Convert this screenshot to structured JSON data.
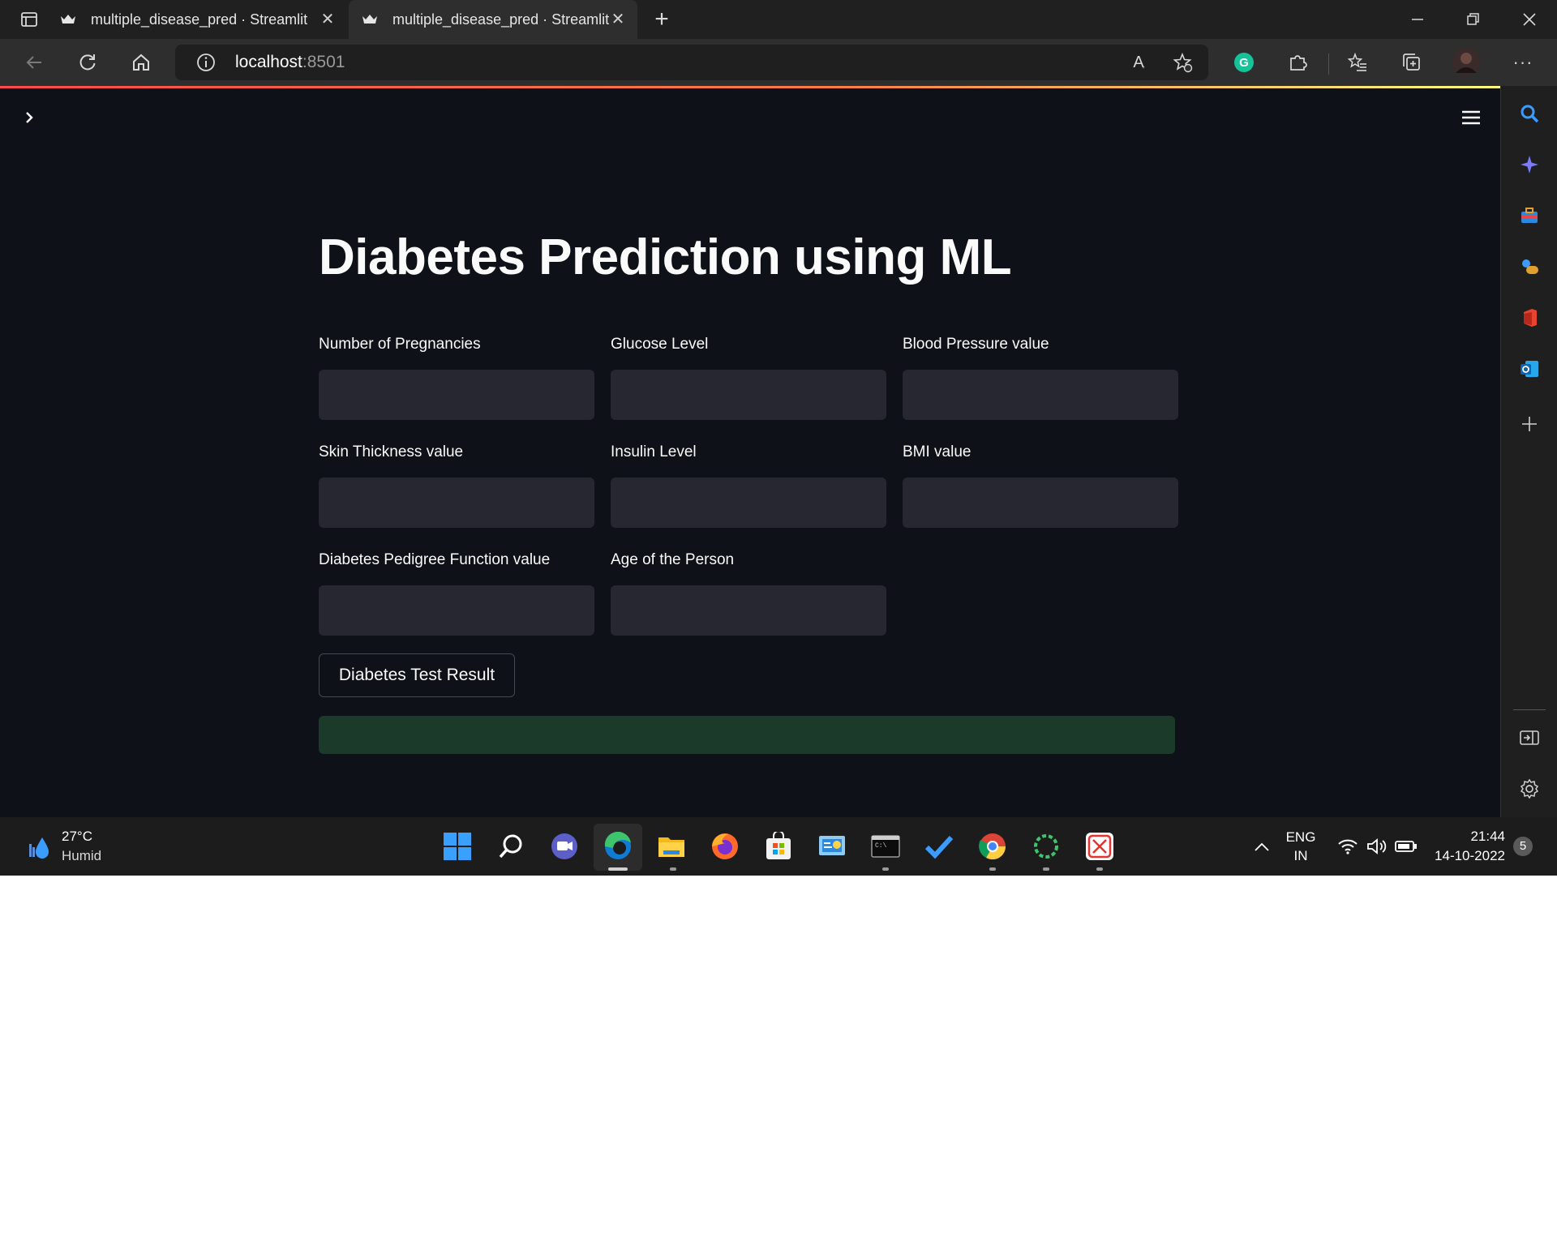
{
  "browser": {
    "tabs": [
      {
        "title": "multiple_disease_pred · Streamlit"
      },
      {
        "title": "multiple_disease_pred · Streamlit"
      }
    ],
    "url_host": "localhost",
    "url_port": ":8501"
  },
  "app": {
    "title": "Diabetes Prediction using ML",
    "fields": [
      {
        "label": "Number of Pregnancies",
        "value": ""
      },
      {
        "label": "Glucose Level",
        "value": ""
      },
      {
        "label": "Blood Pressure value",
        "value": ""
      },
      {
        "label": "Skin Thickness value",
        "value": ""
      },
      {
        "label": "Insulin Level",
        "value": ""
      },
      {
        "label": "BMI value",
        "value": ""
      },
      {
        "label": "Diabetes Pedigree Function value",
        "value": ""
      },
      {
        "label": "Age of the Person",
        "value": ""
      }
    ],
    "button_label": "Diabetes Test Result",
    "result_text": ""
  },
  "taskbar": {
    "weather_temp": "27°C",
    "weather_desc": "Humid",
    "lang_primary": "ENG",
    "lang_secondary": "IN",
    "time": "21:44",
    "date": "14-10-2022",
    "notification_count": "5"
  },
  "colors": {
    "page_bg": "#0e1117",
    "input_bg": "#262730",
    "result_bg": "#1b3a2a",
    "accent_red": "#ff4b4b"
  }
}
